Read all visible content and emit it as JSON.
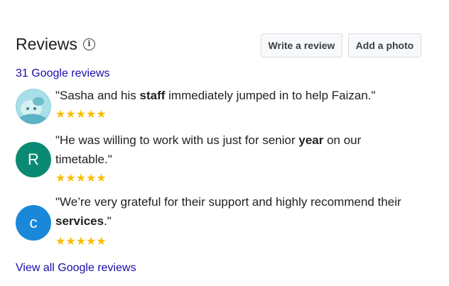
{
  "header": {
    "title": "Reviews",
    "info_icon": "i",
    "write_review_label": "Write a review",
    "add_photo_label": "Add a photo"
  },
  "reviews_count_link": "31 Google reviews",
  "reviews": [
    {
      "avatar_type": "photo",
      "quote_pre": "\"Sasha and his ",
      "quote_bold": "staff",
      "quote_post": " immediately jumped in to help Faizan.\"",
      "rating_stars": "★★★★★",
      "rating": 5
    },
    {
      "avatar_type": "letter",
      "avatar_letter": "R",
      "avatar_color": "#0b8a73",
      "quote_pre": "\"He was willing to work with us just for senior ",
      "quote_bold": "year",
      "quote_post": " on our timetable.\"",
      "rating_stars": "★★★★★",
      "rating": 5
    },
    {
      "avatar_type": "letter",
      "avatar_letter": "c",
      "avatar_color": "#1a88d9",
      "quote_pre": "\"We’re very grateful for their support and highly recommend their ",
      "quote_bold": "services",
      "quote_post": ".\"",
      "rating_stars": "★★★★★",
      "rating": 5
    }
  ],
  "view_all_link": "View all Google reviews",
  "colors": {
    "link": "#1a0dab",
    "star": "#fbbc04",
    "button_bg": "#f8f9fa"
  }
}
